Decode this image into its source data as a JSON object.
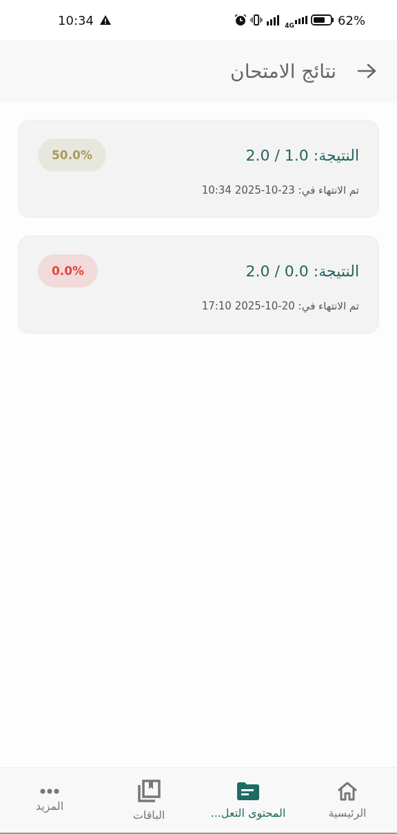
{
  "status_bar": {
    "time": "10:34",
    "network": "4G",
    "battery": "62%"
  },
  "header": {
    "title": "نتائج الامتحان"
  },
  "results": [
    {
      "score": "النتيجة: 1.0 / 2.0",
      "finished": {
        "label": "تم الانتهاء في:",
        "date": "2025-10-23",
        "time": "10:34"
      },
      "percent": "50.0%",
      "color": "#a89a5c"
    },
    {
      "score": "النتيجة: 0.0 / 2.0",
      "finished": {
        "label": "تم الانتهاء في:",
        "date": "2025-10-20",
        "time": "17:10"
      },
      "percent": "0.0%",
      "color": "#e0453a"
    }
  ],
  "bottom_nav": [
    {
      "label": "الرئيسية",
      "kind": "home",
      "selected": false
    },
    {
      "label": "المحتوى التعل...",
      "kind": "folder",
      "selected": true
    },
    {
      "label": "الباقات",
      "kind": "books",
      "selected": false
    },
    {
      "label": "المزيد",
      "kind": "more",
      "selected": false
    }
  ]
}
